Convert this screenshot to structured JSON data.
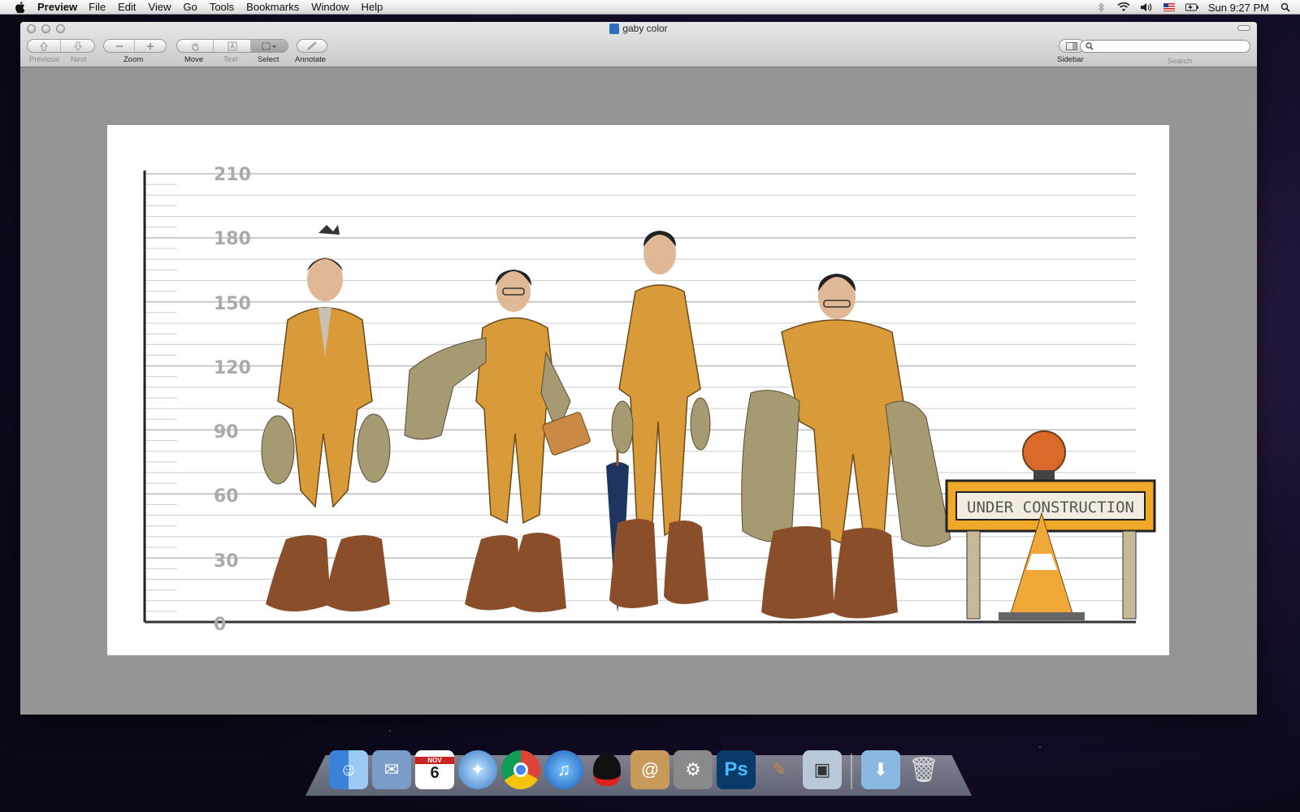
{
  "menubar": {
    "app_name": "Preview",
    "items": [
      "File",
      "Edit",
      "View",
      "Go",
      "Tools",
      "Bookmarks",
      "Window",
      "Help"
    ],
    "clock": "Sun 9:27 PM"
  },
  "window": {
    "title": "gaby color"
  },
  "toolbar": {
    "previous_label": "Previous",
    "next_label": "Next",
    "zoom_label": "Zoom",
    "move_label": "Move",
    "text_label": "Text",
    "select_label": "Select",
    "annotate_label": "Annotate",
    "sidebar_label": "Sidebar",
    "search_label": "Search",
    "search_value": ""
  },
  "document": {
    "ruler_ticks": [
      "210",
      "180",
      "150",
      "120",
      "90",
      "60",
      "30",
      "0"
    ],
    "sign_text": "UNDER CONSTRUCTION",
    "figures": [
      "figure-1",
      "figure-2",
      "figure-3",
      "figure-4"
    ]
  },
  "dock": {
    "items": [
      "finder-icon",
      "mail-icon",
      "calendar-icon",
      "safari-icon",
      "chrome-icon",
      "itunes-icon",
      "qq-icon",
      "address-book-icon",
      "system-preferences-icon",
      "photoshop-icon",
      "brush-app-icon",
      "preview-icon",
      "downloads-stack-icon",
      "trash-icon"
    ],
    "calendar_month": "NOV",
    "calendar_day": "6",
    "photoshop_text": "Ps"
  }
}
